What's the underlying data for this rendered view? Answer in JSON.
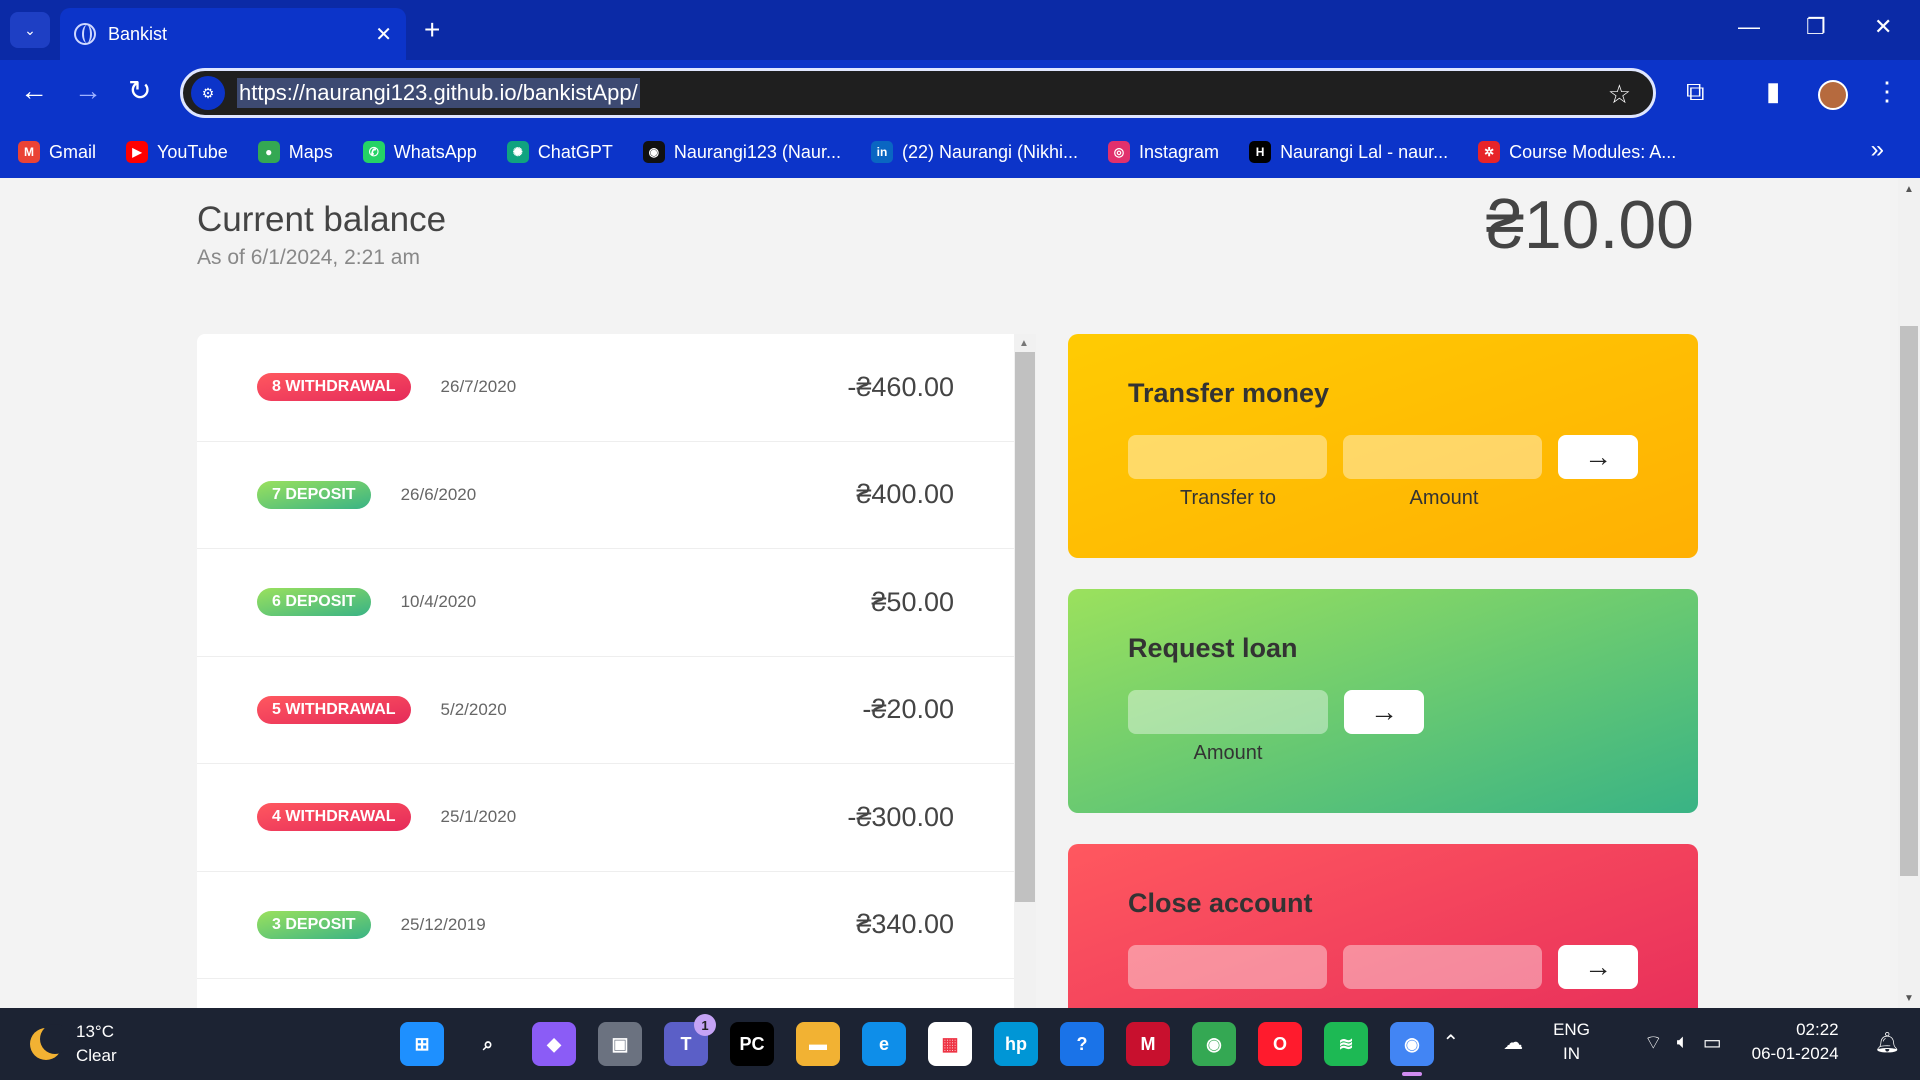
{
  "browser": {
    "tab_title": "Bankist",
    "url": "https://naurangi123.github.io/bankistApp/",
    "bookmarks": [
      {
        "label": "Gmail",
        "icon": "gmail-icon",
        "color": "#ea4335",
        "glyph": "M"
      },
      {
        "label": "YouTube",
        "icon": "youtube-icon",
        "color": "#ff0000",
        "glyph": "▶"
      },
      {
        "label": "Maps",
        "icon": "maps-icon",
        "color": "#34a853",
        "glyph": "●"
      },
      {
        "label": "WhatsApp",
        "icon": "whatsapp-icon",
        "color": "#25d366",
        "glyph": "✆"
      },
      {
        "label": "ChatGPT",
        "icon": "chatgpt-icon",
        "color": "#10a37f",
        "glyph": "✺"
      },
      {
        "label": "Naurangi123 (Naur...",
        "icon": "github-icon",
        "color": "#111111",
        "glyph": "◉"
      },
      {
        "label": "(22) Naurangi (Nikhi...",
        "icon": "linkedin-icon",
        "color": "#0a66c2",
        "glyph": "in"
      },
      {
        "label": "Instagram",
        "icon": "instagram-icon",
        "color": "#e1306c",
        "glyph": "◎"
      },
      {
        "label": "Naurangi Lal - naur...",
        "icon": "hashnode-icon",
        "color": "#000000",
        "glyph": "H"
      },
      {
        "label": "Course Modules: A...",
        "icon": "canvas-icon",
        "color": "#e72429",
        "glyph": "✲"
      }
    ]
  },
  "balance": {
    "label": "Current balance",
    "date": "As of 6/1/2024, 2:21 am",
    "value": "₴10.00"
  },
  "movements": [
    {
      "type": "8 withdrawal",
      "kind": "withdrawal",
      "date": "26/7/2020",
      "value": "-₴460.00"
    },
    {
      "type": "7 deposit",
      "kind": "deposit",
      "date": "26/6/2020",
      "value": "₴400.00"
    },
    {
      "type": "6 deposit",
      "kind": "deposit",
      "date": "10/4/2020",
      "value": "₴50.00"
    },
    {
      "type": "5 withdrawal",
      "kind": "withdrawal",
      "date": "5/2/2020",
      "value": "-₴20.00"
    },
    {
      "type": "4 withdrawal",
      "kind": "withdrawal",
      "date": "25/1/2020",
      "value": "-₴300.00"
    },
    {
      "type": "3 deposit",
      "kind": "deposit",
      "date": "25/12/2019",
      "value": "₴340.00"
    }
  ],
  "operations": {
    "transfer": {
      "title": "Transfer money",
      "label_to": "Transfer to",
      "label_amount": "Amount",
      "button": "→"
    },
    "loan": {
      "title": "Request loan",
      "label_amount": "Amount",
      "button": "→"
    },
    "close": {
      "title": "Close account",
      "button": "→"
    }
  },
  "taskbar": {
    "temp": "13°C",
    "weather": "Clear",
    "lang_1": "ENG",
    "lang_2": "IN",
    "time": "02:22",
    "date": "06-01-2024",
    "teams_badge": "1",
    "apps": [
      {
        "name": "start-icon",
        "color": "#1e90ff",
        "glyph": "⊞"
      },
      {
        "name": "search-icon",
        "color": "transparent",
        "glyph": "⌕"
      },
      {
        "name": "copilot-icon",
        "color": "#8b5cf6",
        "glyph": "◆"
      },
      {
        "name": "task-view-icon",
        "color": "#6b7280",
        "glyph": "▣"
      },
      {
        "name": "teams-icon",
        "color": "#5b5fc7",
        "glyph": "T"
      },
      {
        "name": "pycharm-icon",
        "color": "#000000",
        "glyph": "PC"
      },
      {
        "name": "file-explorer-icon",
        "color": "#f2b233",
        "glyph": "▬"
      },
      {
        "name": "edge-icon",
        "color": "#0e8ee9",
        "glyph": "e"
      },
      {
        "name": "store-icon",
        "color": "#ffffff",
        "glyph": "▦"
      },
      {
        "name": "myhp-icon",
        "color": "#0096d6",
        "glyph": "hp"
      },
      {
        "name": "help-icon",
        "color": "#1a73e8",
        "glyph": "?"
      },
      {
        "name": "mcafee-icon",
        "color": "#c8102e",
        "glyph": "M"
      },
      {
        "name": "chrome-icon",
        "color": "#34a853",
        "glyph": "◉"
      },
      {
        "name": "opera-icon",
        "color": "#ff1b2d",
        "glyph": "O"
      },
      {
        "name": "spotify-icon",
        "color": "#1db954",
        "glyph": "≋"
      },
      {
        "name": "chrome-active-icon",
        "color": "#4285f4",
        "glyph": "◉"
      }
    ]
  }
}
